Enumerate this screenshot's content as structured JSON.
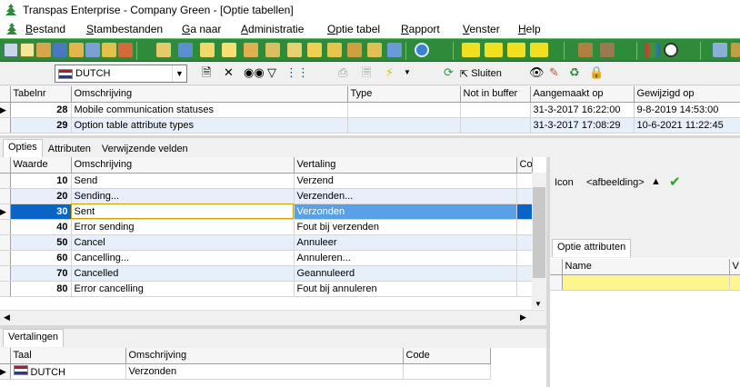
{
  "window": {
    "title": "Transpas Enterprise - Company Green - [Optie tabellen]"
  },
  "menu": [
    "Bestand",
    "Stambestanden",
    "Ga naar",
    "Administratie",
    "Optie tabel",
    "Rapport",
    "Venster",
    "Help"
  ],
  "toolbar": {
    "language": "DUTCH",
    "close_label": "Sluiten"
  },
  "tables_grid": {
    "columns": [
      "Tabelnr",
      "Omschrijving",
      "Type",
      "Not in buffer",
      "Aangemaakt op",
      "Gewijzigd op"
    ],
    "rows": [
      {
        "nr": "28",
        "desc": "Mobile communication statuses",
        "type": "",
        "nib": "",
        "created": "31-3-2017 16:22:00",
        "modified": "9-8-2019 14:53:00"
      },
      {
        "nr": "29",
        "desc": "Option table attribute types",
        "type": "",
        "nib": "",
        "created": "31-3-2017 17:08:29",
        "modified": "10-6-2021 11:22:45"
      }
    ]
  },
  "detail_tabs": [
    "Opties",
    "Attributen",
    "Verwijzende velden"
  ],
  "options_grid": {
    "columns": [
      "Waarde",
      "Omschrijving",
      "Vertaling",
      "Co"
    ],
    "rows": [
      {
        "val": "10",
        "desc": "Send",
        "trans": "Verzend"
      },
      {
        "val": "20",
        "desc": "Sending...",
        "trans": "Verzenden..."
      },
      {
        "val": "30",
        "desc": "Sent",
        "trans": "Verzonden"
      },
      {
        "val": "40",
        "desc": "Error sending",
        "trans": "Fout bij verzenden"
      },
      {
        "val": "50",
        "desc": "Cancel",
        "trans": "Annuleer"
      },
      {
        "val": "60",
        "desc": "Cancelling...",
        "trans": "Annuleren..."
      },
      {
        "val": "70",
        "desc": "Cancelled",
        "trans": "Geannuleerd"
      },
      {
        "val": "80",
        "desc": "Error cancelling",
        "trans": "Fout bij annuleren"
      }
    ]
  },
  "icon_field": {
    "label": "Icon",
    "value": "<afbeelding>"
  },
  "option_attributes": {
    "tab": "Optie attributen",
    "columns": [
      "Name",
      "V"
    ]
  },
  "translations": {
    "tab": "Vertalingen",
    "columns": [
      "Taal",
      "Omschrijving",
      "Code"
    ],
    "rows": [
      {
        "lang": "DUTCH",
        "desc": "Verzonden",
        "code": ""
      }
    ]
  }
}
